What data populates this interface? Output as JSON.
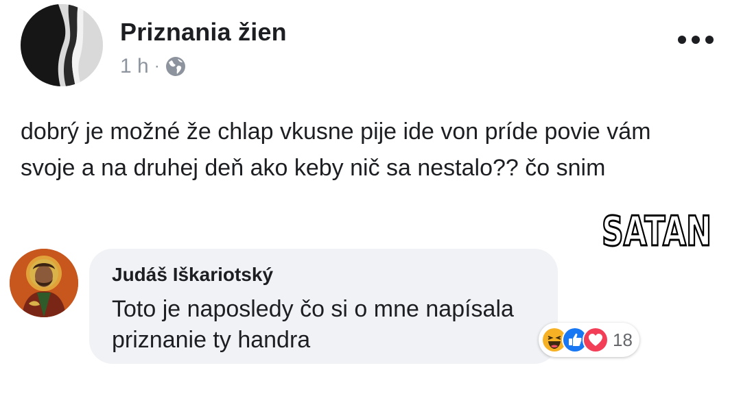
{
  "post": {
    "author": "Priznania žien",
    "time": "1 h",
    "separator": "·",
    "privacy_icon": "globe-icon",
    "text": "dobrý je možné že chlap vkusne pije ide von príde povie vám svoje a na druhej deň ako keby nič sa nestalo?? čo snim",
    "more_icon": "more-dots-icon"
  },
  "sticker": {
    "text": "SATAN"
  },
  "comment": {
    "author": "Judáš Iškariotský",
    "text": "Toto je naposledy čo si o mne napísala priznanie ty handra",
    "reactions": {
      "icons": [
        "haha-icon",
        "like-icon",
        "love-icon"
      ],
      "count": "18"
    }
  },
  "colors": {
    "text": "#1c1e21",
    "meta": "#8d949e",
    "bubble": "#f0f2f5",
    "like": "#1877f2",
    "love": "#f33e58",
    "haha": "#f7b125"
  }
}
